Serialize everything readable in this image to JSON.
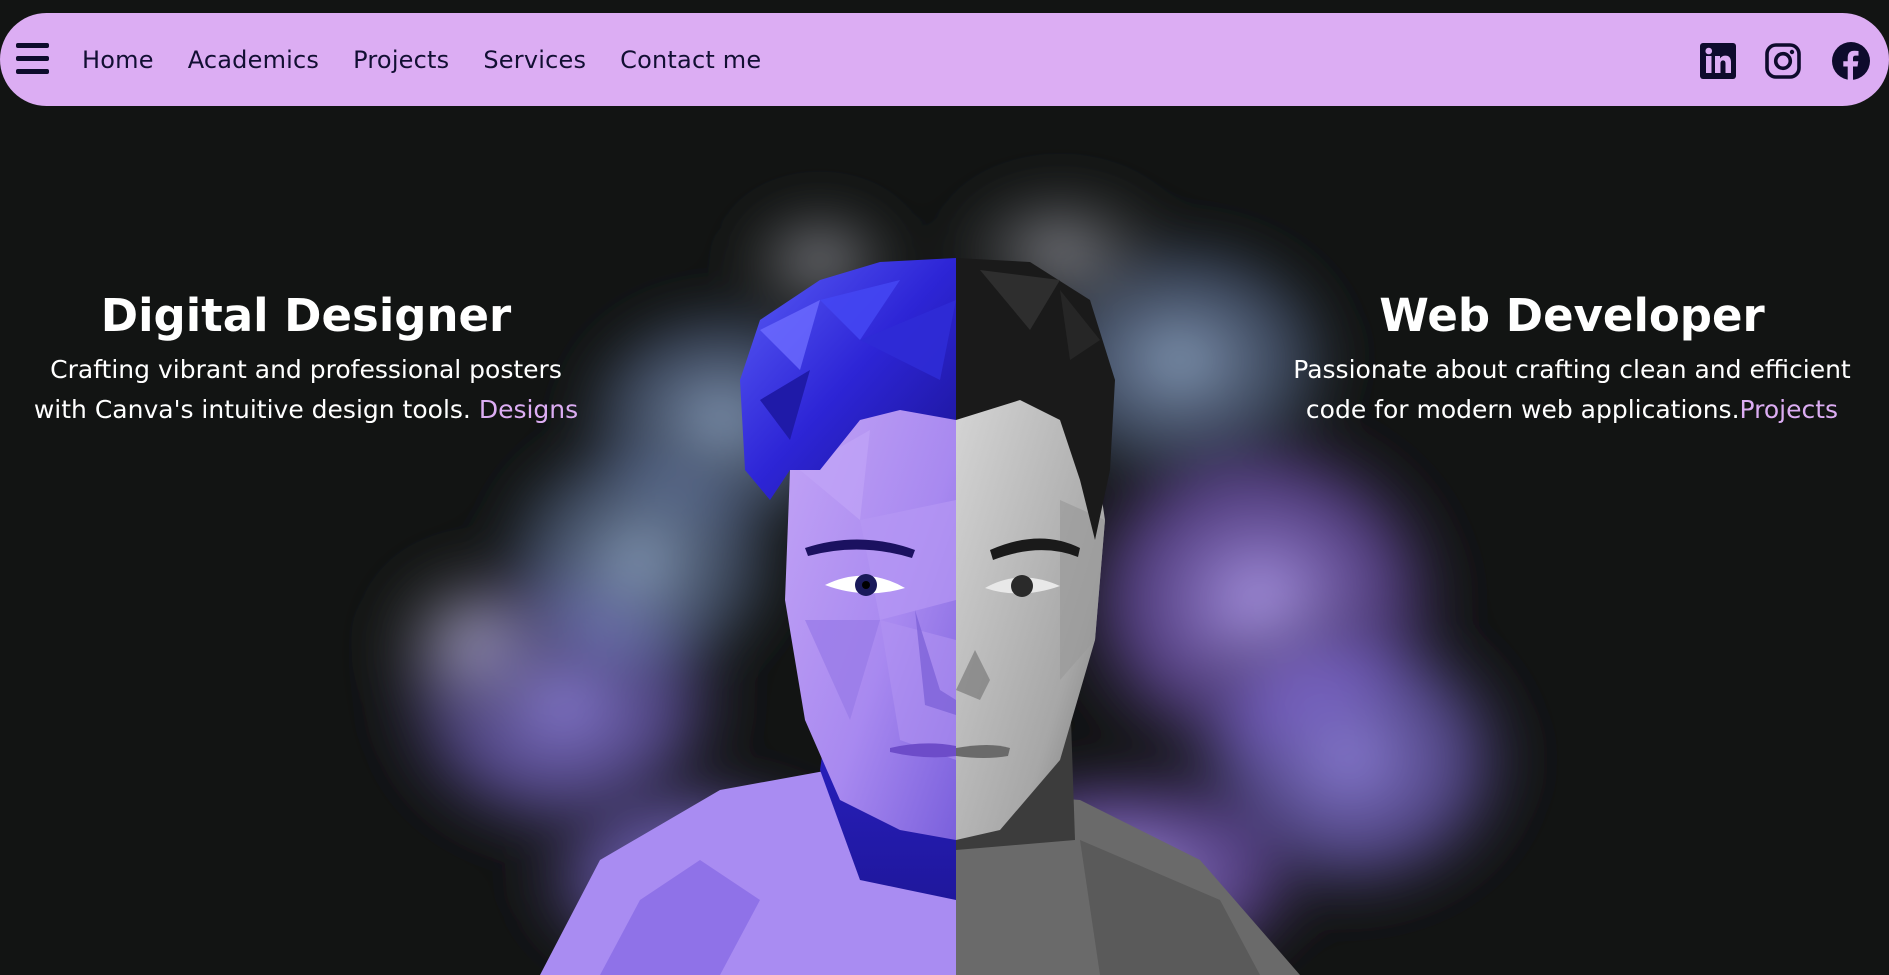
{
  "nav": {
    "menu_icon": "hamburger-menu-icon",
    "links": [
      {
        "label": "Home"
      },
      {
        "label": "Academics"
      },
      {
        "label": "Projects"
      },
      {
        "label": "Services"
      },
      {
        "label": "Contact me"
      }
    ],
    "social": [
      {
        "icon": "linkedin-icon"
      },
      {
        "icon": "instagram-icon"
      },
      {
        "icon": "facebook-icon"
      }
    ]
  },
  "hero": {
    "left": {
      "title": "Digital Designer",
      "line1": "Crafting vibrant and professional posters",
      "line2": "with Canva's intuitive design tools.",
      "link": "Designs"
    },
    "right": {
      "title": "Web Developer",
      "line1": "Passionate about crafting clean and efficient",
      "line2": "code for modern web applications.",
      "link": "Projects"
    }
  },
  "colors": {
    "background": "#121413",
    "nav_background": "#dcadf3",
    "nav_text": "#120f33",
    "accent": "#dcadf3",
    "portrait_left_tint": "#5b3df0",
    "portrait_right_tint": "#8a8a8a"
  }
}
